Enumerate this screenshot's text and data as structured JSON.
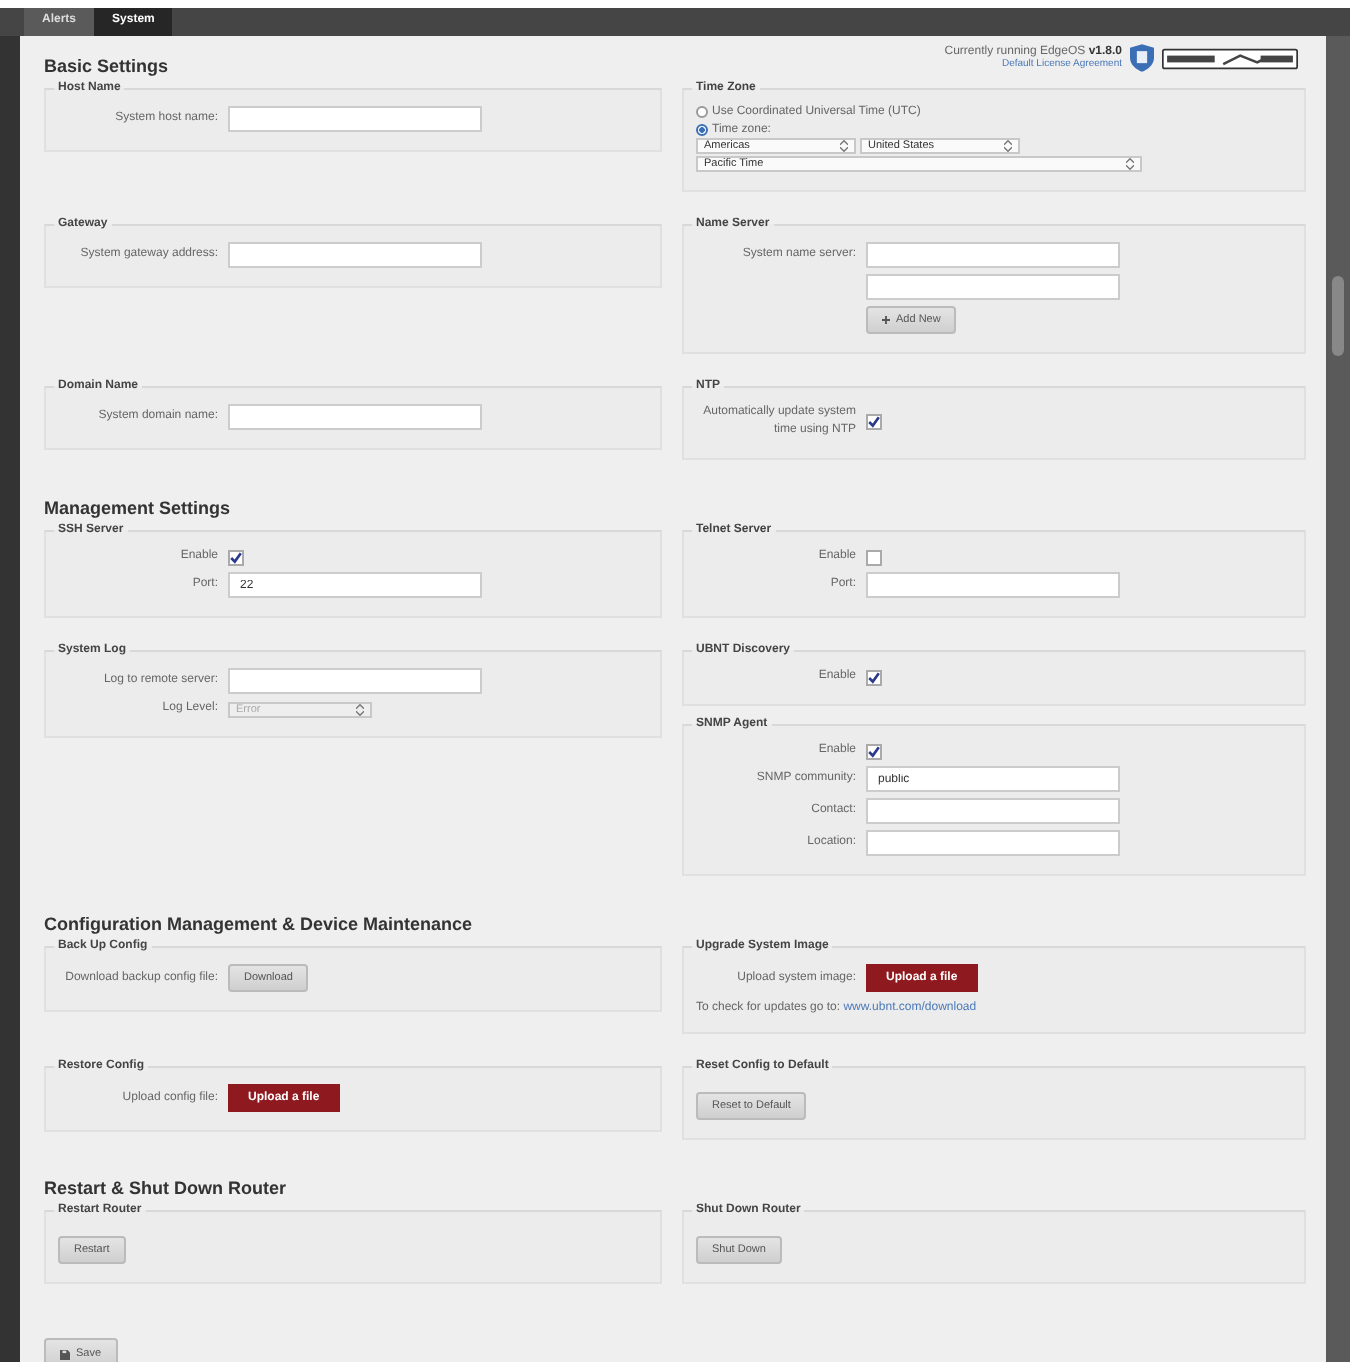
{
  "tabs": [
    {
      "label": "Alerts",
      "selected": false
    },
    {
      "label": "System",
      "selected": true
    }
  ],
  "version_info": {
    "text": "Currently running EdgeOS **v1.8.0**",
    "link": "Default License Agreement"
  },
  "sections": [
    {
      "title": "Basic Settings",
      "rows": [
        [
          [
            {
              "legend": "Host Name",
              "fields": [
                {
                  "kind": "text",
                  "label": "System host name:"
                }
              ]
            }
          ],
          [
            {
              "legend": "Time Zone",
              "fields": [
                {
                  "kind": "radio",
                  "label": "Use Coordinated Universal Time (UTC)",
                  "selected": false
                },
                {
                  "kind": "radio",
                  "label": "Time zone:",
                  "selected": true
                },
                {
                  "kind": "selects",
                  "options": [
                    "Americas",
                    "United States"
                  ]
                },
                {
                  "kind": "wide_select",
                  "value": "Pacific Time"
                }
              ]
            }
          ]
        ],
        [
          [
            {
              "legend": "Gateway",
              "fields": [
                {
                  "kind": "text",
                  "label": "System gateway address:"
                }
              ]
            }
          ],
          [
            {
              "legend": "Name Server",
              "fields": [
                {
                  "kind": "text",
                  "label": "System name server:"
                },
                {
                  "kind": "text"
                },
                {
                  "kind": "add_button",
                  "text": "Add New"
                }
              ]
            }
          ]
        ],
        [
          [
            {
              "legend": "Domain Name",
              "fields": [
                {
                  "kind": "text",
                  "label": "System domain name:"
                }
              ]
            }
          ],
          [
            {
              "legend": "NTP",
              "fields": [
                {
                  "kind": "checkbox",
                  "label": "Automatically update system time using NTP",
                  "checked": true
                }
              ]
            }
          ]
        ]
      ]
    },
    {
      "title": "Management Settings",
      "rows": [
        [
          [
            {
              "legend": "SSH Server",
              "fields": [
                {
                  "kind": "checkbox",
                  "label": "Enable",
                  "checked": true
                },
                {
                  "kind": "text",
                  "label": "Port:",
                  "value": "22"
                }
              ]
            }
          ],
          [
            {
              "legend": "Telnet Server",
              "fields": [
                {
                  "kind": "checkbox",
                  "label": "Enable",
                  "checked": false
                },
                {
                  "kind": "text",
                  "label": "Port:"
                }
              ]
            }
          ]
        ],
        [
          [
            {
              "legend": "System Log",
              "fields": [
                {
                  "kind": "text",
                  "label": "Log to remote server:"
                },
                {
                  "kind": "select",
                  "label": "Log Level:",
                  "value": "Error",
                  "disabled": true
                }
              ]
            }
          ],
          [
            {
              "legend": "UBNT Discovery",
              "fields": [
                {
                  "kind": "checkbox",
                  "label": "Enable",
                  "checked": true
                }
              ]
            },
            {
              "legend": "SNMP Agent",
              "fields": [
                {
                  "kind": "checkbox",
                  "label": "Enable",
                  "checked": true
                },
                {
                  "kind": "text",
                  "label": "SNMP community:",
                  "value": "public"
                },
                {
                  "kind": "text",
                  "label": "Contact:"
                },
                {
                  "kind": "text",
                  "label": "Location:"
                }
              ]
            }
          ]
        ]
      ]
    },
    {
      "title": "Configuration Management & Device Maintenance",
      "rows": [
        [
          [
            {
              "legend": "Back Up Config",
              "fields": [
                {
                  "kind": "labeled_button",
                  "label": "Download backup config file:",
                  "text": "Download"
                }
              ]
            }
          ],
          [
            {
              "legend": "Upgrade System Image",
              "fields": [
                {
                  "kind": "upload",
                  "label": "Upload system image:",
                  "text": "Upload a file"
                },
                {
                  "kind": "note",
                  "text": "To check for updates go to:",
                  "link": "www.ubnt.com/download"
                }
              ]
            }
          ]
        ],
        [
          [
            {
              "legend": "Restore Config",
              "fields": [
                {
                  "kind": "upload",
                  "label": "Upload config file:",
                  "text": "Upload a file"
                }
              ]
            }
          ],
          [
            {
              "legend": "Reset Config to Default",
              "fields": [
                {
                  "kind": "button",
                  "text": "Reset to Default"
                }
              ]
            }
          ]
        ]
      ]
    },
    {
      "title": "Restart & Shut Down Router",
      "rows": [
        [
          [
            {
              "legend": "Restart Router",
              "fields": [
                {
                  "kind": "button",
                  "text": "Restart"
                }
              ]
            }
          ],
          [
            {
              "legend": "Shut Down Router",
              "fields": [
                {
                  "kind": "button",
                  "text": "Shut Down"
                }
              ]
            }
          ]
        ]
      ]
    }
  ],
  "save_button": "Save"
}
